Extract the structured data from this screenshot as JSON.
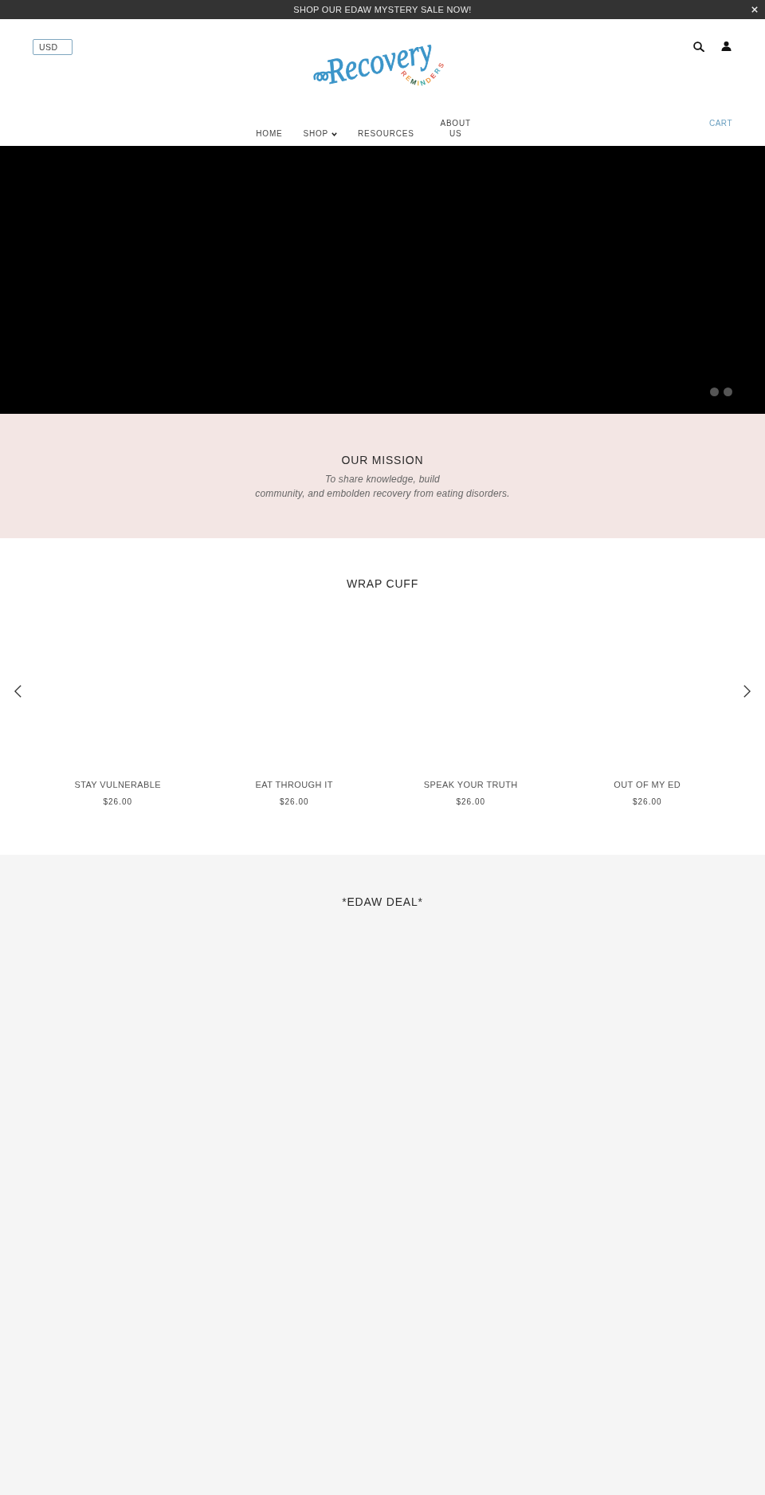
{
  "announcement_bar": {
    "text": "SHOP OUR EDAW MYSTERY SALE NOW!"
  },
  "header": {
    "currency": "USD",
    "logo": {
      "script": "Recovery",
      "tagline": "REMINDERS"
    },
    "nav": [
      {
        "label": "HOME",
        "dropdown": false
      },
      {
        "label": "SHOP",
        "dropdown": true
      },
      {
        "label": "RESOURCES",
        "dropdown": false
      },
      {
        "label": "ABOUT US",
        "dropdown": false
      }
    ],
    "cart": "CART"
  },
  "hero": {
    "slide_dots": [
      {
        "selected": false
      },
      {
        "selected": false
      }
    ]
  },
  "mission": {
    "title": "OUR MISSION",
    "text": "To share knowledge, build\ncommunity, and embolden recovery from eating disorders."
  },
  "featured_collection": {
    "title": "WRAP CUFF",
    "products": [
      {
        "name": "STAY VULNERABLE",
        "price": "$26.00"
      },
      {
        "name": "EAT THROUGH IT",
        "price": "$26.00"
      },
      {
        "name": "SPEAK YOUR TRUTH",
        "price": "$26.00"
      },
      {
        "name": "OUT OF MY ED",
        "price": "$26.00"
      }
    ]
  },
  "deal_section": {
    "title": "*EDAW DEAL*"
  }
}
